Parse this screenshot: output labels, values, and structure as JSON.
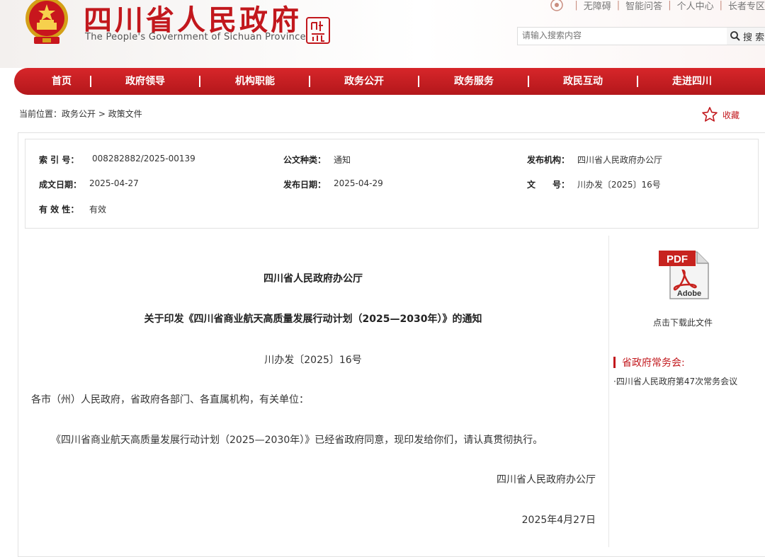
{
  "header": {
    "site_title": "四川省人民政府",
    "site_subtitle": "The People's Government of Sichuan Province",
    "top_links": [
      "无障碍",
      "智能问答",
      "个人中心",
      "长者专区"
    ],
    "search_placeholder": "请输入搜索内容",
    "search_button": "搜 索",
    "brand_color": "#c2181d"
  },
  "nav": {
    "items": [
      "首页",
      "政府领导",
      "机构职能",
      "政务公开",
      "政务服务",
      "政民互动",
      "走进四川"
    ]
  },
  "breadcrumb": {
    "prefix": "当前位置：",
    "path": "政务公开 > 政策文件"
  },
  "favorite_label": "收藏",
  "meta": {
    "index_label": "索 引 号：",
    "index_value": "008282882/2025-00139",
    "doc_type_label": "公文种类：",
    "doc_type_value": "通知",
    "publisher_label": "发布机构：",
    "publisher_value": "四川省人民政府办公厅",
    "created_label": "成文日期：",
    "created_value": "2025-04-27",
    "published_label": "发布日期：",
    "published_value": "2025-04-29",
    "docnum_label": "文　　号：",
    "docnum_value": "川办发〔2025〕16号",
    "validity_label": "有 效 性：",
    "validity_value": "有效"
  },
  "document": {
    "issuer": "四川省人民政府办公厅",
    "title": "关于印发《四川省商业航天高质量发展行动计划（2025—2030年）》的通知",
    "number": "川办发〔2025〕16号",
    "addressee": "各市（州）人民政府，省政府各部门、各直属机构，有关单位：",
    "body": "《四川省商业航天高质量发展行动计划（2025—2030年）》已经省政府同意，现印发给你们，请认真贯彻执行。",
    "signer": "四川省人民政府办公厅",
    "date": "2025年4月27日"
  },
  "sidebar": {
    "pdf_badge": "PDF",
    "pdf_brand": "Adobe",
    "download_label": "点击下载此文件",
    "section_title": "省政府常务会:",
    "links": [
      "·四川省人民政府第47次常务会议"
    ]
  }
}
